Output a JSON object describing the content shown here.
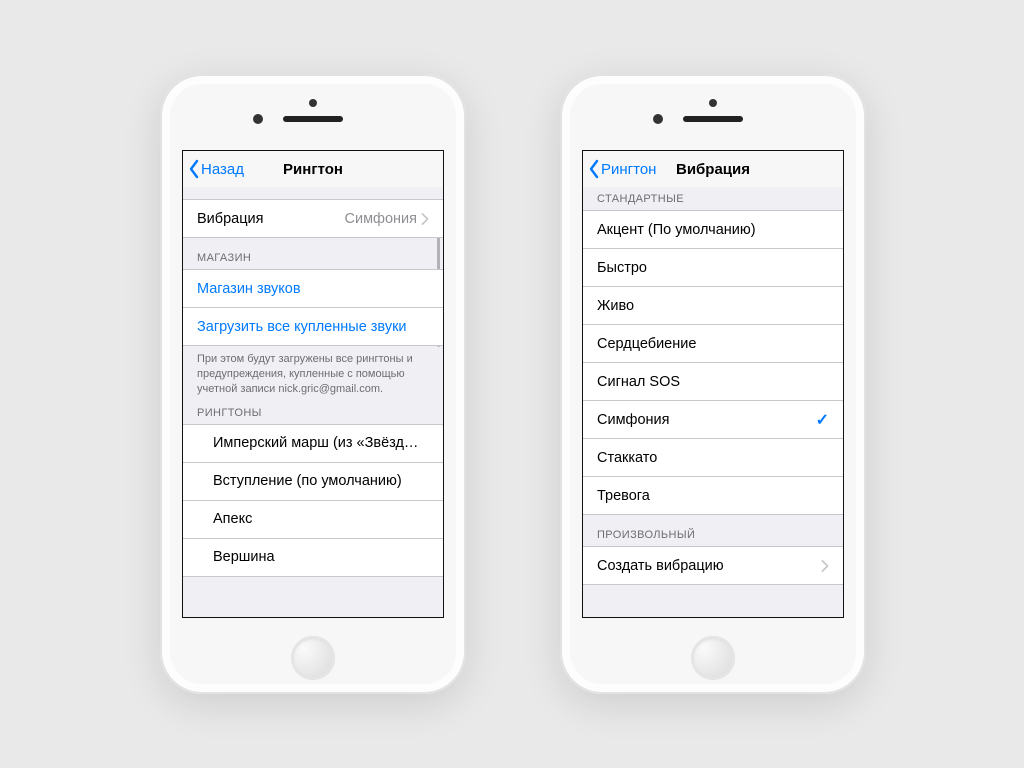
{
  "colors": {
    "ios_blue": "#007aff",
    "secondary_text": "#8e8e93",
    "hairline": "#c8c7cc"
  },
  "left": {
    "back_label": "Назад",
    "title": "Рингтон",
    "vibration_row": {
      "label": "Вибрация",
      "value": "Симфония"
    },
    "store_header": "МАГАЗИН",
    "store": {
      "tone_store": "Магазин звуков",
      "download_all": "Загрузить все купленные звуки"
    },
    "store_footer": "При этом будут загружены все рингтоны и предупреждения, купленные с помощью учетной записи nick.gric@gmail.com.",
    "ringtones_header": "РИНГТОНЫ",
    "ringtones": [
      "Имперский марш (из «Звёзд…",
      "Вступление (по умолчанию)",
      "Апекс",
      "Вершина"
    ]
  },
  "right": {
    "back_label": "Рингтон",
    "title": "Вибрация",
    "standard_header": "СТАНДАРТНЫЕ",
    "standard": [
      {
        "label": "Акцент (По умолчанию)",
        "selected": false
      },
      {
        "label": "Быстро",
        "selected": false
      },
      {
        "label": "Живо",
        "selected": false
      },
      {
        "label": "Сердцебиение",
        "selected": false
      },
      {
        "label": "Сигнал SOS",
        "selected": false
      },
      {
        "label": "Симфония",
        "selected": true
      },
      {
        "label": "Стаккато",
        "selected": false
      },
      {
        "label": "Тревога",
        "selected": false
      }
    ],
    "custom_header": "ПРОИЗВОЛЬНЫЙ",
    "create_label": "Создать вибрацию"
  }
}
